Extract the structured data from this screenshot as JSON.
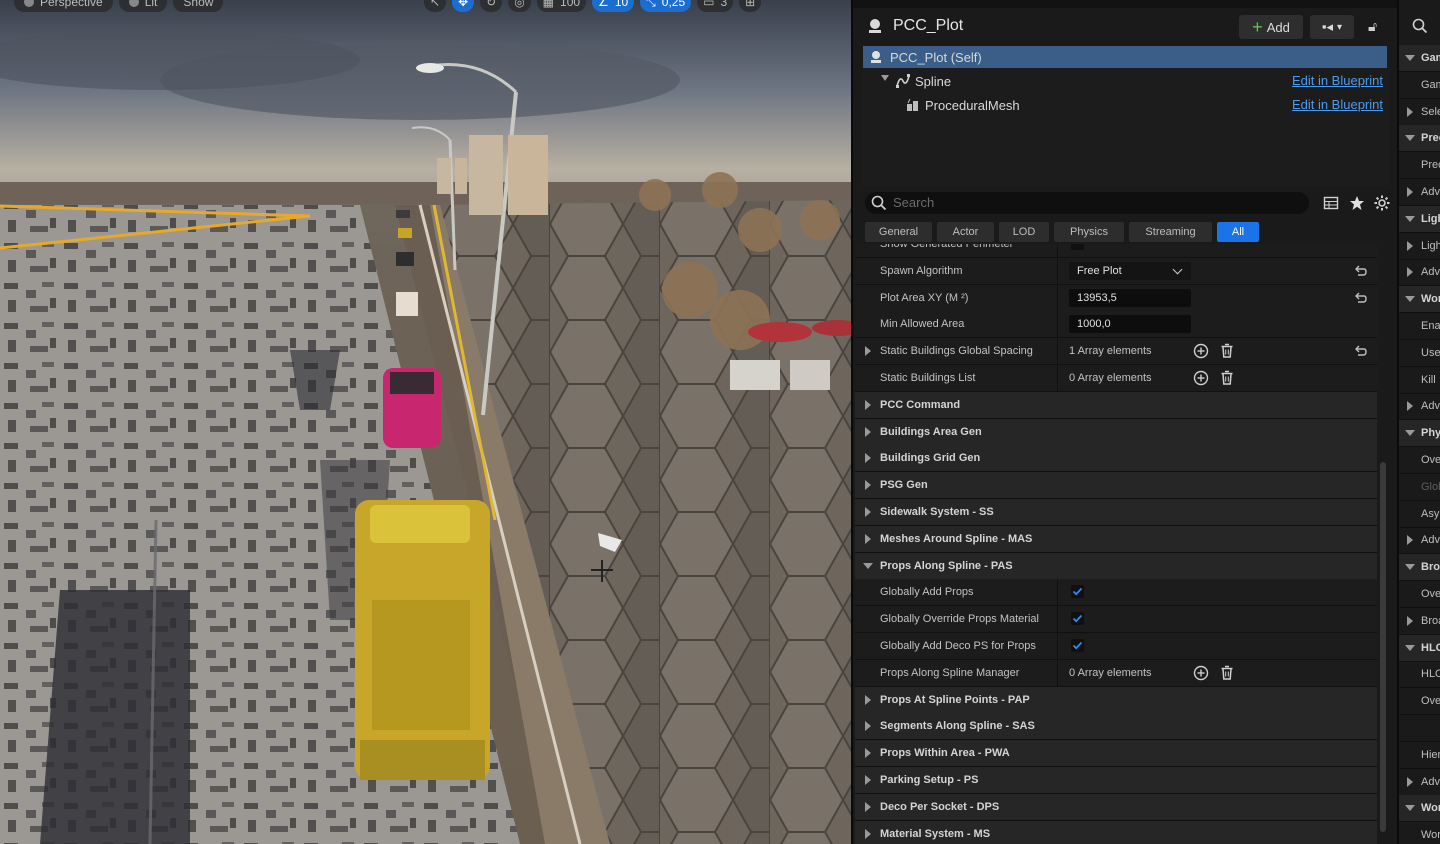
{
  "viewport": {
    "toolbar": [
      "Perspective",
      "Lit",
      "Show",
      "100",
      "10",
      "0,25",
      "3"
    ]
  },
  "details": {
    "title": "PCC_Plot",
    "add_label": "Add",
    "components": [
      {
        "label": "PCC_Plot (Self)",
        "action": ""
      },
      {
        "label": "Spline",
        "action": "Edit in Blueprint"
      },
      {
        "label": "ProceduralMesh",
        "action": "Edit in Blueprint"
      }
    ],
    "search_placeholder": "Search",
    "filters": [
      "General",
      "Actor",
      "LOD",
      "Physics",
      "Streaming",
      "All"
    ],
    "rows": [
      {
        "name": "Show Generated Perimeter",
        "type": "check",
        "value": false
      },
      {
        "name": "Spawn Algorithm",
        "type": "combo",
        "value": "Free Plot",
        "reset": true
      },
      {
        "name": "Plot Area XY (M ²)",
        "type": "number",
        "value": "13953,5",
        "reset": true
      },
      {
        "name": "Min Allowed Area",
        "type": "number",
        "value": "1000,0"
      },
      {
        "name": "Static Buildings Global Spacing",
        "type": "array",
        "value": "1 Array elements",
        "expandable": true,
        "reset": true
      },
      {
        "name": "Static Buildings List",
        "type": "array",
        "value": "0 Array elements"
      },
      {
        "name": "PCC Command",
        "type": "category"
      },
      {
        "name": "Buildings Area Gen",
        "type": "category"
      },
      {
        "name": "Buildings Grid Gen",
        "type": "category"
      },
      {
        "name": "PSG Gen",
        "type": "category"
      },
      {
        "name": "Sidewalk System - SS",
        "type": "category"
      },
      {
        "name": "Meshes Around Spline - MAS",
        "type": "category"
      },
      {
        "name": "Props Along Spline - PAS",
        "type": "category",
        "open": true
      },
      {
        "name": "Globally Add Props",
        "type": "check",
        "value": true
      },
      {
        "name": "Globally Override Props Material",
        "type": "check",
        "value": true
      },
      {
        "name": "Globally Add Deco PS for Props",
        "type": "check",
        "value": true
      },
      {
        "name": "Props Along Spline Manager",
        "type": "array",
        "value": "0 Array elements"
      },
      {
        "name": "Props At Spline Points - PAP",
        "type": "category"
      },
      {
        "name": "Segments Along Spline - SAS",
        "type": "category"
      },
      {
        "name": "Props Within Area - PWA",
        "type": "category"
      },
      {
        "name": "Parking Setup - PS",
        "type": "category"
      },
      {
        "name": "Deco Per Socket - DPS",
        "type": "category"
      },
      {
        "name": "Material System - MS",
        "type": "category"
      }
    ]
  },
  "right_strip": {
    "rows": [
      {
        "t": "Gam",
        "cat": true,
        "open": true
      },
      {
        "t": "Gam"
      },
      {
        "t": "Sele",
        "arrow": true
      },
      {
        "t": "Prec",
        "cat": true,
        "open": true
      },
      {
        "t": "Prec"
      },
      {
        "t": "Adv",
        "arrow": true
      },
      {
        "t": "Ligh",
        "cat": true,
        "open": true
      },
      {
        "t": "Ligh",
        "arrow": true
      },
      {
        "t": "Adv",
        "arrow": true
      },
      {
        "t": "Wor",
        "cat": true,
        "open": true
      },
      {
        "t": "Enal"
      },
      {
        "t": "Use"
      },
      {
        "t": "Kill"
      },
      {
        "t": "Adv",
        "arrow": true
      },
      {
        "t": "Phy",
        "cat": true,
        "open": true
      },
      {
        "t": "Ove"
      },
      {
        "t": "Glob",
        "dim": true
      },
      {
        "t": "Asy"
      },
      {
        "t": "Adv",
        "arrow": true
      },
      {
        "t": "Broa",
        "cat": true,
        "open": true
      },
      {
        "t": "Ove"
      },
      {
        "t": "Broa",
        "arrow": true
      },
      {
        "t": "HLO",
        "cat": true,
        "open": true
      },
      {
        "t": "HLO"
      },
      {
        "t": "Ove"
      },
      {
        "t": ""
      },
      {
        "t": "Hier"
      },
      {
        "t": "Adv",
        "arrow": true
      },
      {
        "t": "Wor",
        "cat": true,
        "open": true
      },
      {
        "t": "Worl"
      }
    ]
  },
  "colors": {
    "accent": "#1b73e8",
    "selection": "#3b5e88",
    "link": "#4c9bf0"
  }
}
